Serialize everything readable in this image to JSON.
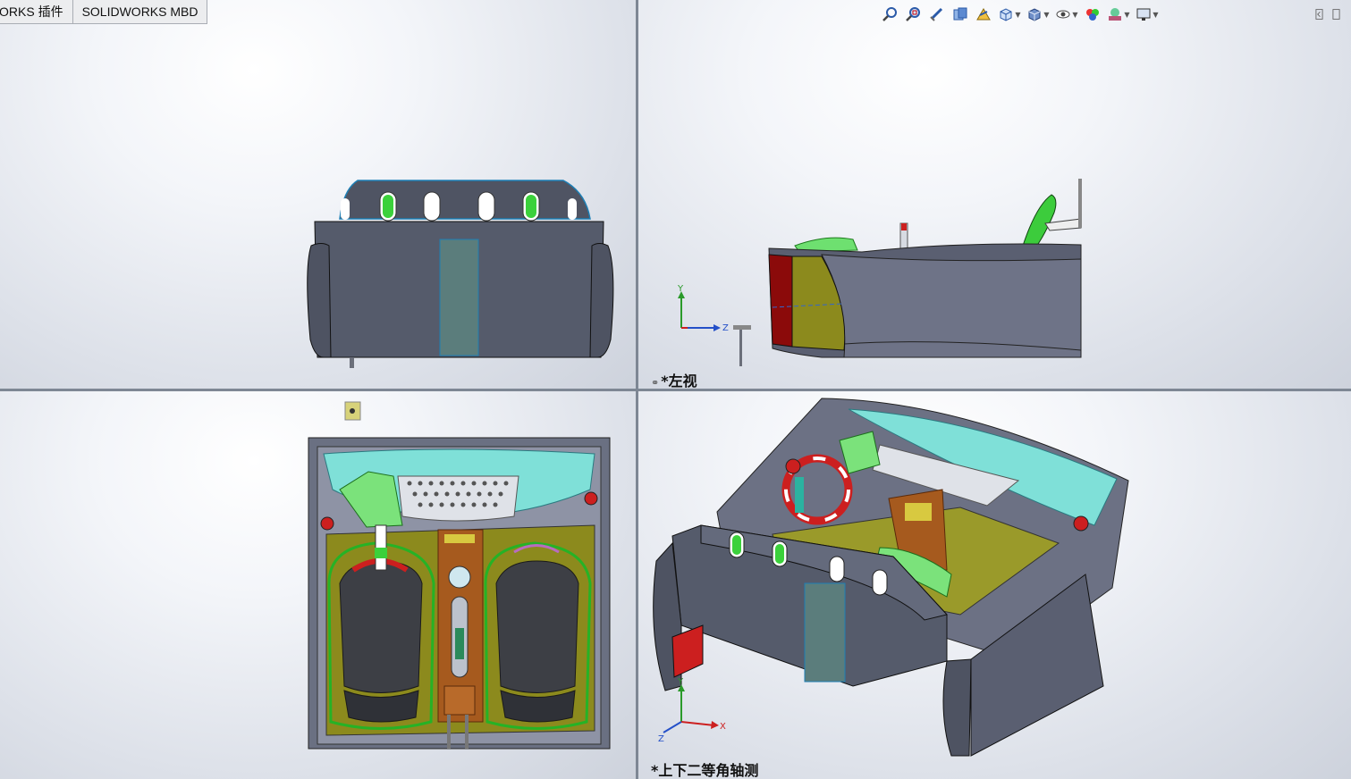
{
  "command_tabs": [
    "ORKS 插件",
    "SOLIDWORKS MBD"
  ],
  "toolbar_icons": [
    "zoom-to-fit-icon",
    "zoom-to-area-icon",
    "previous-view-icon",
    "section-view-icon",
    "dynamic-annotation-icon",
    "view-orientation-icon",
    "display-style-icon",
    "hide-show-items-icon",
    "edit-appearance-icon",
    "apply-scene-icon",
    "view-settings-icon"
  ],
  "viewports": {
    "top_left": {
      "label": ""
    },
    "top_right": {
      "label": "*左视"
    },
    "bottom_left": {
      "label": ""
    },
    "bottom_right": {
      "label": "*上下二等角轴测"
    }
  },
  "triad": {
    "x": "X",
    "y": "Y",
    "z": "Z"
  },
  "colors": {
    "body": "#555b6b",
    "accent_green": "#5fd35f",
    "accent_cyan": "#7fe0d8",
    "accent_red": "#cc1f1f",
    "panel_olive": "#8c8a1d"
  }
}
